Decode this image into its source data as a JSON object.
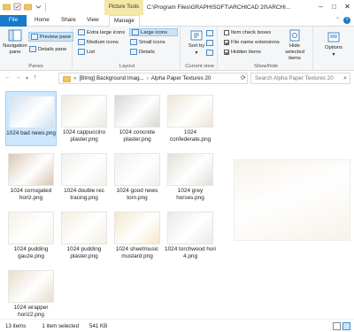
{
  "window": {
    "title": "C:\\Program Files\\GRAPHISOFT\\ARCHICAD 20\\ARCHI...",
    "context_tab_header": "Picture Tools",
    "controls": [
      "minimize",
      "maximize",
      "close"
    ]
  },
  "tabs": {
    "file": "File",
    "home": "Home",
    "share": "Share",
    "view": "View",
    "manage": "Manage"
  },
  "ribbon": {
    "panes": {
      "navigation_pane": "Navigation pane",
      "preview_pane": "Preview pane",
      "details_pane": "Details pane",
      "label": "Panes"
    },
    "layout": {
      "extra_large": "Extra large icons",
      "large": "Large icons",
      "medium": "Medium icons",
      "small": "Small icons",
      "list": "List",
      "details": "Details",
      "label": "Layout"
    },
    "current_view": {
      "sort_by": "Sort by",
      "label": "Current view"
    },
    "show_hide": {
      "item_check_boxes": "Item check boxes",
      "file_name_extensions": "File name extensions",
      "hidden_items": "Hidden items",
      "hide_selected": "Hide selected items",
      "label": "Show/hide"
    },
    "options": "Options"
  },
  "address": {
    "crumbs": [
      "[BImg] Background Imag...",
      "Alpha Paper Textures 20"
    ],
    "search_placeholder": "Search Alpha Paper Textures 20"
  },
  "files": [
    {
      "name": "1024 bad news.png",
      "color": "#cfe0f0",
      "selected": true
    },
    {
      "name": "1024 cappuccino plaster.png",
      "color": "#ece9e1",
      "selected": false
    },
    {
      "name": "1024 concrete plaster.png",
      "color": "#d6d6d3",
      "selected": false
    },
    {
      "name": "1024 confederate.png",
      "color": "#ece5d7",
      "selected": false
    },
    {
      "name": "1024 corrugated horiz.png",
      "color": "#d9c8b6",
      "selected": false
    },
    {
      "name": "1024 double rec tracing.png",
      "color": "#f2f0ea",
      "selected": false
    },
    {
      "name": "1024 good news torn.png",
      "color": "#efefef",
      "selected": false
    },
    {
      "name": "1024 grey horses.png",
      "color": "#e3dfd7",
      "selected": false
    },
    {
      "name": "1024 pudding gauze.png",
      "color": "#f5f2e4",
      "selected": false
    },
    {
      "name": "1024 pudding plaster.png",
      "color": "#f3efe0",
      "selected": false
    },
    {
      "name": "1024 sheetmusic mustard.png",
      "color": "#f2e8c8",
      "selected": false
    },
    {
      "name": "1024 torchwood hori 4.png",
      "color": "#ebeae6",
      "selected": false
    },
    {
      "name": "1024 wrapper horiz2.png",
      "color": "#e6dccb",
      "selected": false
    }
  ],
  "preview": {
    "color": "#f7f3ea"
  },
  "status": {
    "count": "13 items",
    "selected": "1 item selected",
    "size": "541 KB"
  }
}
